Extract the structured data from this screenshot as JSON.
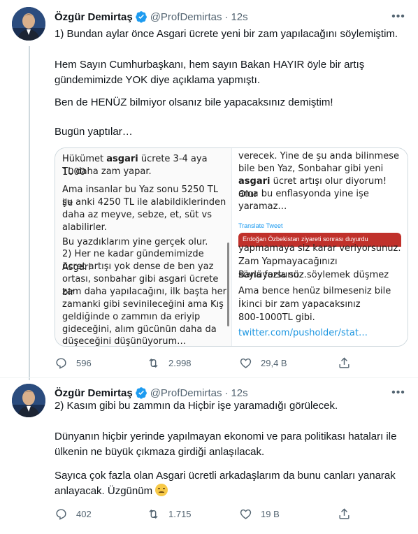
{
  "tweets": [
    {
      "author": {
        "name": "Özgür Demirtaş",
        "handle": "@ProfDemirtas",
        "verified": true
      },
      "time": "12s",
      "paragraphs": [
        "1) Bundan aylar önce Asgari ücrete yeni bir zam yapılacağını söylemiştim.",
        "Hem Sayın Cumhurbaşkanı, hem sayın Bakan HAYIR öyle bir artış gündemimizde YOK diye açıklama yapmıştı.",
        "Ben de HENÜZ bilmiyor olsanız bile yapacaksınız demiştim!",
        "Bugün yaptılar…"
      ],
      "card": {
        "left_lines": [
          "Hükümet asgari ücrete 3-4 aya 1000",
          "TL daha zam yapar.",
          "Ama insanlar bu Yaz sonu 5250 TL ile",
          "şu anki 4250 TL ile alabildiklerinden",
          "daha az meyve, sebze, et, süt vs",
          "alabilirler.",
          "Bu yazdıklarım yine gerçek olur.",
          "2) Her ne kadar gündemimizde Asgari",
          "ücret artışı yok dense de ben yaz",
          "ortası, sonbahar gibi asgari ücrete bir",
          "zam daha yapılacağını, ilk başta her",
          "zamanki gibi sevinileceğini ama Kış",
          "geldiğinde o zammın da eriyip",
          "gideceğini, alım gücünün daha da",
          "düşeceğini düşünüyorum…"
        ],
        "right_top_lines": [
          "verecek. Yine de şu anda bilinmese",
          "bile ben Yaz, Sonbahar gibi yeni",
          "asgari ücret artışı olur diyorum! Olur",
          "ama bu enflasyonda yine işe",
          "yaramaz…"
        ],
        "translate_label": "Translate Tweet",
        "thumb_caption": "Erdoğan Özbekistan ziyareti sonrası duyurdu",
        "right_bottom_lines": [
          "yapmamaya siz karar veriyorsunuz.",
          "Zam Yapmayacağınızı söylüyorsunuz.",
          "Bana fazla söz söylemek düşmez",
          "Ama bence henüz bilmeseniz bile",
          "İkinci bir zam yapacaksınız",
          "800-1000TL gibi."
        ],
        "link": "twitter.com/pusholder/stat…"
      },
      "stats": {
        "replies": "596",
        "retweets": "2.998",
        "likes": "29,4 B"
      }
    },
    {
      "author": {
        "name": "Özgür Demirtaş",
        "handle": "@ProfDemirtas",
        "verified": true
      },
      "time": "12s",
      "paragraphs": [
        "2) Kasım gibi bu zammın da Hiçbir işe yaramadığı görülecek.",
        "Dünyanın hiçbir yerinde yapılmayan ekonomi ve para politikası hataları ile ülkenin ne büyük çıkmaza girdiği anlaşılacak.",
        "Sayıca çok fazla olan Asgari ücretli arkadaşlarım da bunu canları yanarak anlayacak. Üzgünüm"
      ],
      "stats": {
        "replies": "402",
        "retweets": "1.715",
        "likes": "19 B"
      }
    }
  ],
  "colors": {
    "accent": "#1d9bf0",
    "muted": "#536471",
    "text": "#0f1419",
    "thread_line": "#cfd9de"
  },
  "icons": [
    "verified-badge-icon",
    "more-dots-icon",
    "reply-icon",
    "retweet-icon",
    "like-icon",
    "share-icon",
    "disappointed-face-emoji"
  ]
}
